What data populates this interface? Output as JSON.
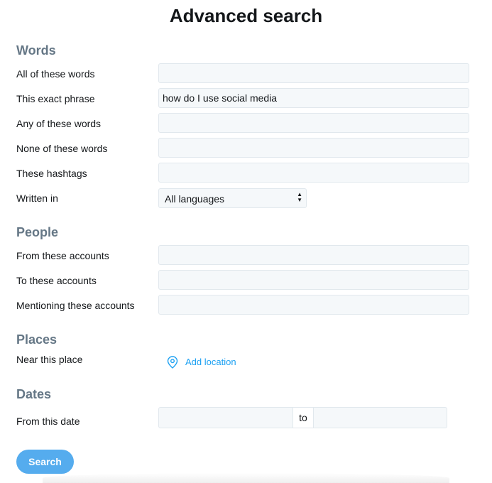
{
  "page": {
    "title": "Advanced search"
  },
  "words": {
    "heading": "Words",
    "all_label": "All of these words",
    "all_value": "",
    "exact_label": "This exact phrase",
    "exact_value": "how do I use social media",
    "any_label": "Any of these words",
    "any_value": "",
    "none_label": "None of these words",
    "none_value": "",
    "hashtags_label": "These hashtags",
    "hashtags_value": "",
    "language_label": "Written in",
    "language_value": "All languages"
  },
  "people": {
    "heading": "People",
    "from_label": "From these accounts",
    "from_value": "",
    "to_label": "To these accounts",
    "to_value": "",
    "mention_label": "Mentioning these accounts",
    "mention_value": ""
  },
  "places": {
    "heading": "Places",
    "near_label": "Near this place",
    "add_location": "Add location",
    "icon": "location-pin-icon"
  },
  "dates": {
    "heading": "Dates",
    "from_label": "From this date",
    "to_label": "to"
  },
  "actions": {
    "search": "Search"
  },
  "colors": {
    "accent": "#1da1f2",
    "button": "#55acee",
    "heading": "#657786",
    "field_bg": "#f5f8fa",
    "field_border": "#e1e8ed"
  }
}
